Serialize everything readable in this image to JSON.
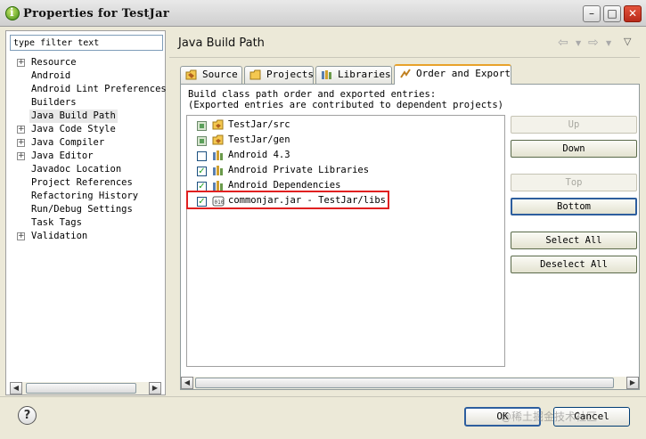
{
  "window": {
    "title": "Properties for TestJar"
  },
  "filter": {
    "placeholder": "type filter text"
  },
  "tree": [
    {
      "label": "Resource",
      "expandable": true
    },
    {
      "label": "Android",
      "expandable": false
    },
    {
      "label": "Android Lint Preferences",
      "expandable": false
    },
    {
      "label": "Builders",
      "expandable": false
    },
    {
      "label": "Java Build Path",
      "expandable": false,
      "selected": true
    },
    {
      "label": "Java Code Style",
      "expandable": true
    },
    {
      "label": "Java Compiler",
      "expandable": true
    },
    {
      "label": "Java Editor",
      "expandable": true
    },
    {
      "label": "Javadoc Location",
      "expandable": false
    },
    {
      "label": "Project References",
      "expandable": false
    },
    {
      "label": "Refactoring History",
      "expandable": false
    },
    {
      "label": "Run/Debug Settings",
      "expandable": false
    },
    {
      "label": "Task Tags",
      "expandable": false
    },
    {
      "label": "Validation",
      "expandable": true
    }
  ],
  "page": {
    "title": "Java Build Path",
    "tabs": [
      {
        "label": "Source",
        "icon": "source-folder-icon"
      },
      {
        "label": "Projects",
        "icon": "projects-folder-icon"
      },
      {
        "label": "Libraries",
        "icon": "libraries-icon"
      },
      {
        "label": "Order and Export",
        "icon": "order-export-icon",
        "active": true
      }
    ],
    "description_line1": "Build class path order and exported entries:",
    "description_line2": "(Exported entries are contributed to dependent projects)",
    "entries": [
      {
        "label": "TestJar/src",
        "state": "grayed",
        "icon": "source-folder-icon"
      },
      {
        "label": "TestJar/gen",
        "state": "grayed",
        "icon": "source-folder-icon"
      },
      {
        "label": "Android 4.3",
        "state": "unchecked",
        "icon": "library-icon"
      },
      {
        "label": "Android Private Libraries",
        "state": "checked",
        "icon": "library-icon"
      },
      {
        "label": "Android Dependencies",
        "state": "checked",
        "icon": "library-icon"
      },
      {
        "label": "commonjar.jar - TestJar/libs",
        "state": "checked",
        "icon": "jar-icon",
        "highlighted": true
      }
    ],
    "buttons": {
      "up": "Up",
      "down": "Down",
      "top": "Top",
      "bottom": "Bottom",
      "select_all": "Select All",
      "deselect_all": "Deselect All"
    }
  },
  "footer": {
    "help": "?",
    "ok": "OK",
    "cancel": "Cancel",
    "watermark": "@稀土掘金技术社区"
  },
  "colors": {
    "highlight_box": "#e02020",
    "active_tab_accent": "#e8a22b"
  }
}
